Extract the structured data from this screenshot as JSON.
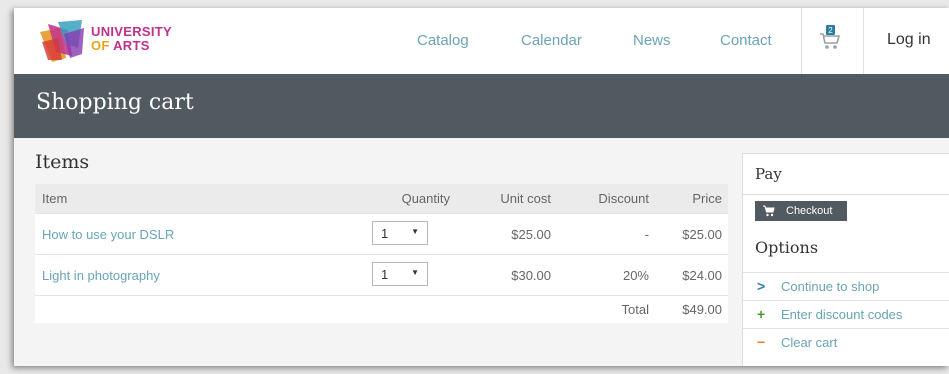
{
  "header": {
    "logo": {
      "line1": "UNIVERSITY",
      "line2_of": "OF",
      "line2_arts": "ARTS"
    },
    "nav": [
      "Catalog",
      "Calendar",
      "News",
      "Contact"
    ],
    "cart_icon": "shopping-cart-icon",
    "login_label": "Log in"
  },
  "page": {
    "title": "Shopping cart"
  },
  "items": {
    "title": "Items",
    "columns": {
      "item": "Item",
      "quantity": "Quantity",
      "unit_cost": "Unit cost",
      "discount": "Discount",
      "price": "Price"
    },
    "rows": [
      {
        "name": "How to use your DSLR",
        "quantity": "1",
        "unit_cost": "$25.00",
        "discount": "-",
        "price": "$25.00"
      },
      {
        "name": "Light in photography",
        "quantity": "1",
        "unit_cost": "$30.00",
        "discount": "20%",
        "price": "$24.00"
      }
    ],
    "total_label": "Total",
    "total_value": "$49.00"
  },
  "pay": {
    "title": "Pay",
    "checkout_label": "Checkout",
    "options_title": "Options",
    "options": [
      {
        "icon": "chevron-right-icon",
        "label": "Continue to shop",
        "color": "#2b7ea0"
      },
      {
        "icon": "plus-icon",
        "label": "Enter discount codes",
        "color": "#4b9b2b"
      },
      {
        "icon": "minus-icon",
        "label": "Clear cart",
        "color": "#d9822b"
      }
    ]
  },
  "colors": {
    "link": "#6aa4b6",
    "banner": "#525a61",
    "brand": "#c0308a"
  }
}
